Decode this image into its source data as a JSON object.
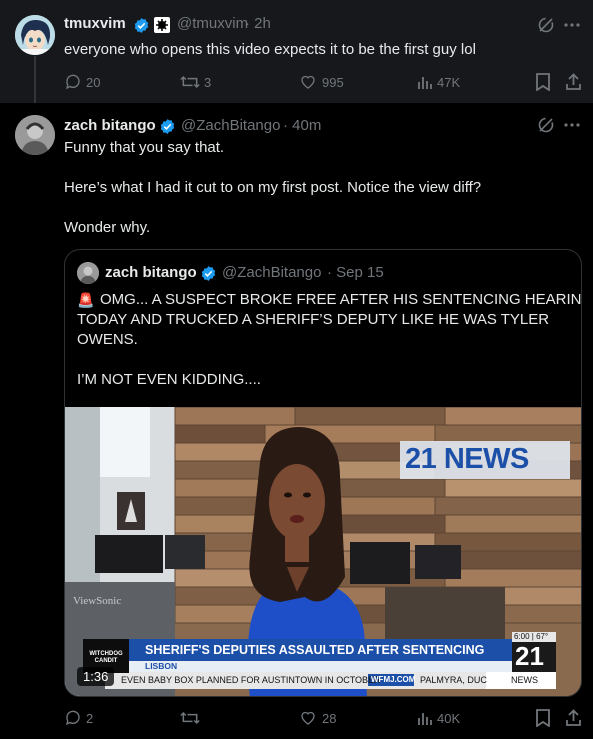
{
  "tweet1": {
    "name": "tmuxvim",
    "handle": "@tmuxvim",
    "time": "· 2h",
    "text": "everyone who opens this video expects it to be the first guy lol",
    "actions": {
      "replies": "20",
      "reposts": "3",
      "likes": "995",
      "views": "47K"
    }
  },
  "tweet2": {
    "name": "zach bitango",
    "handle": "@ZachBitango",
    "time": "· 40m",
    "lines": [
      "Funny that you say that.",
      "Here’s what I had it cut to on my first post. Notice the view diff?",
      "Wonder why."
    ],
    "quote": {
      "name": "zach bitango",
      "handle": "@ZachBitango",
      "time": "· Sep 15",
      "emoji": "🚨",
      "lines": [
        "OMG... A SUSPECT BROKE FREE AFTER HIS SENTENCING HEARING",
        "TODAY AND TRUCKED A SHERIFF’S DEPUTY LIKE HE WAS TYLER",
        "OWENS.",
        "I’M NOT EVEN KIDDING...."
      ],
      "video": {
        "duration": "1:36",
        "station_logo": "21 NEWS",
        "monitor_brand": "ViewSonic",
        "watermark": "WITCHDOG CANDIT",
        "headline": "SHERIFF'S DEPUTIES ASSAULTED AFTER SENTENCING",
        "location": "LISBON",
        "ticker": "EVEN BABY BOX PLANNED FOR AUSTINTOWN IN OCTOBER",
        "ticker_site": "WFMJ.COM",
        "ticker_next": "PALMYRA, DUC",
        "time_temp": "6:00 | 67°",
        "corner_number": "21",
        "corner_label": "NEWS"
      }
    },
    "actions": {
      "replies": "2",
      "reposts": "",
      "likes": "28",
      "views": "40K"
    }
  },
  "colors": {
    "background": "#000000",
    "highlight": "#16181c",
    "text": "#e7e9ea",
    "muted": "#71767b",
    "verified": "#1d9bf0",
    "border": "#2f3336"
  }
}
